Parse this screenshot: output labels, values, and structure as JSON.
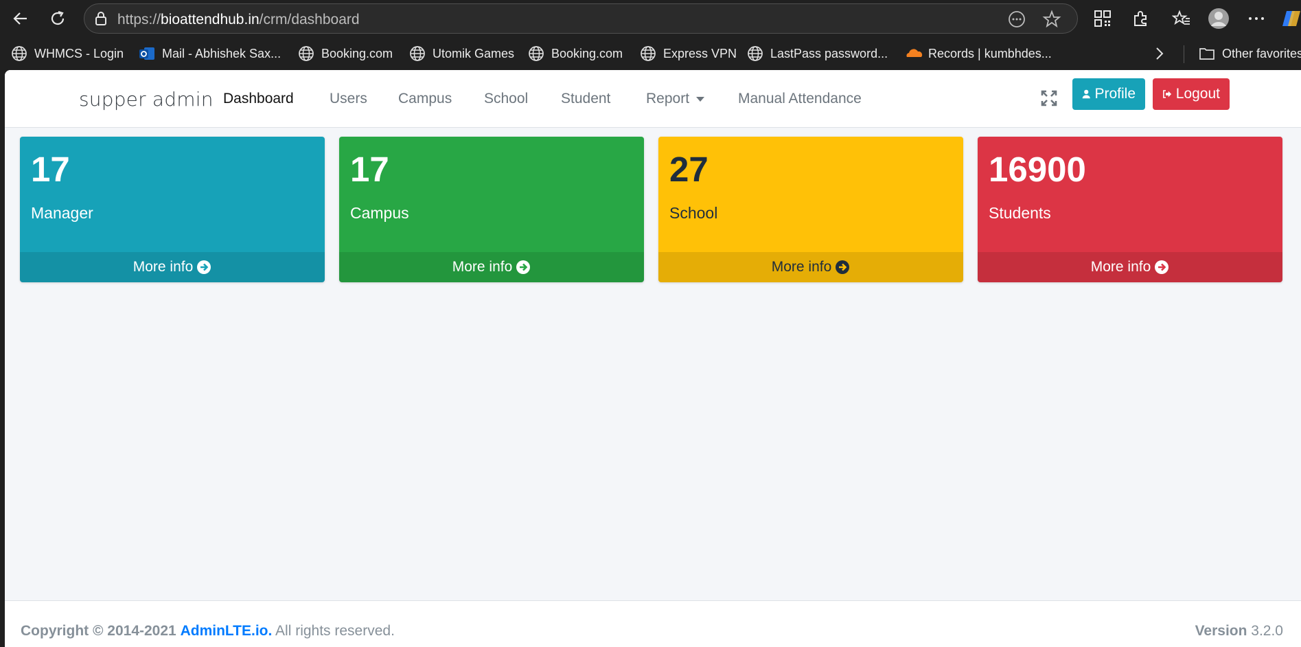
{
  "browser": {
    "url_scheme": "https://",
    "url_host": "bioattendhub.in",
    "url_path": "/crm/dashboard",
    "bookmarks": [
      {
        "label": "WHMCS - Login",
        "icon": "globe-icon"
      },
      {
        "label": "Mail - Abhishek Sax...",
        "icon": "outlook-icon"
      },
      {
        "label": "Booking.com",
        "icon": "globe-icon"
      },
      {
        "label": "Utomik Games",
        "icon": "globe-icon"
      },
      {
        "label": "Booking.com",
        "icon": "globe-icon"
      },
      {
        "label": "Express VPN",
        "icon": "globe-icon"
      },
      {
        "label": "LastPass password...",
        "icon": "globe-icon"
      },
      {
        "label": "Records | kumbhdes...",
        "icon": "cloudflare-icon"
      }
    ],
    "other_favorites": "Other favorites"
  },
  "navbar": {
    "brand": "supper admin",
    "links": [
      "Dashboard",
      "Users",
      "Campus",
      "School",
      "Student",
      "Report",
      "Manual Attendance"
    ],
    "active": "Dashboard",
    "profile_label": "Profile",
    "logout_label": "Logout"
  },
  "stats": [
    {
      "value": "17",
      "label": "Manager",
      "more": "More info",
      "color": "#17a2b8"
    },
    {
      "value": "17",
      "label": "Campus",
      "more": "More info",
      "color": "#28a745"
    },
    {
      "value": "27",
      "label": "School",
      "more": "More info",
      "color": "#ffc107"
    },
    {
      "value": "16900",
      "label": "Students",
      "more": "More info",
      "color": "#dc3545"
    }
  ],
  "footer": {
    "copyright_prefix": "Copyright © 2014-2021",
    "link": "AdminLTE.io.",
    "suffix": "All rights reserved.",
    "version_label": "Version",
    "version_value": "3.2.0"
  }
}
